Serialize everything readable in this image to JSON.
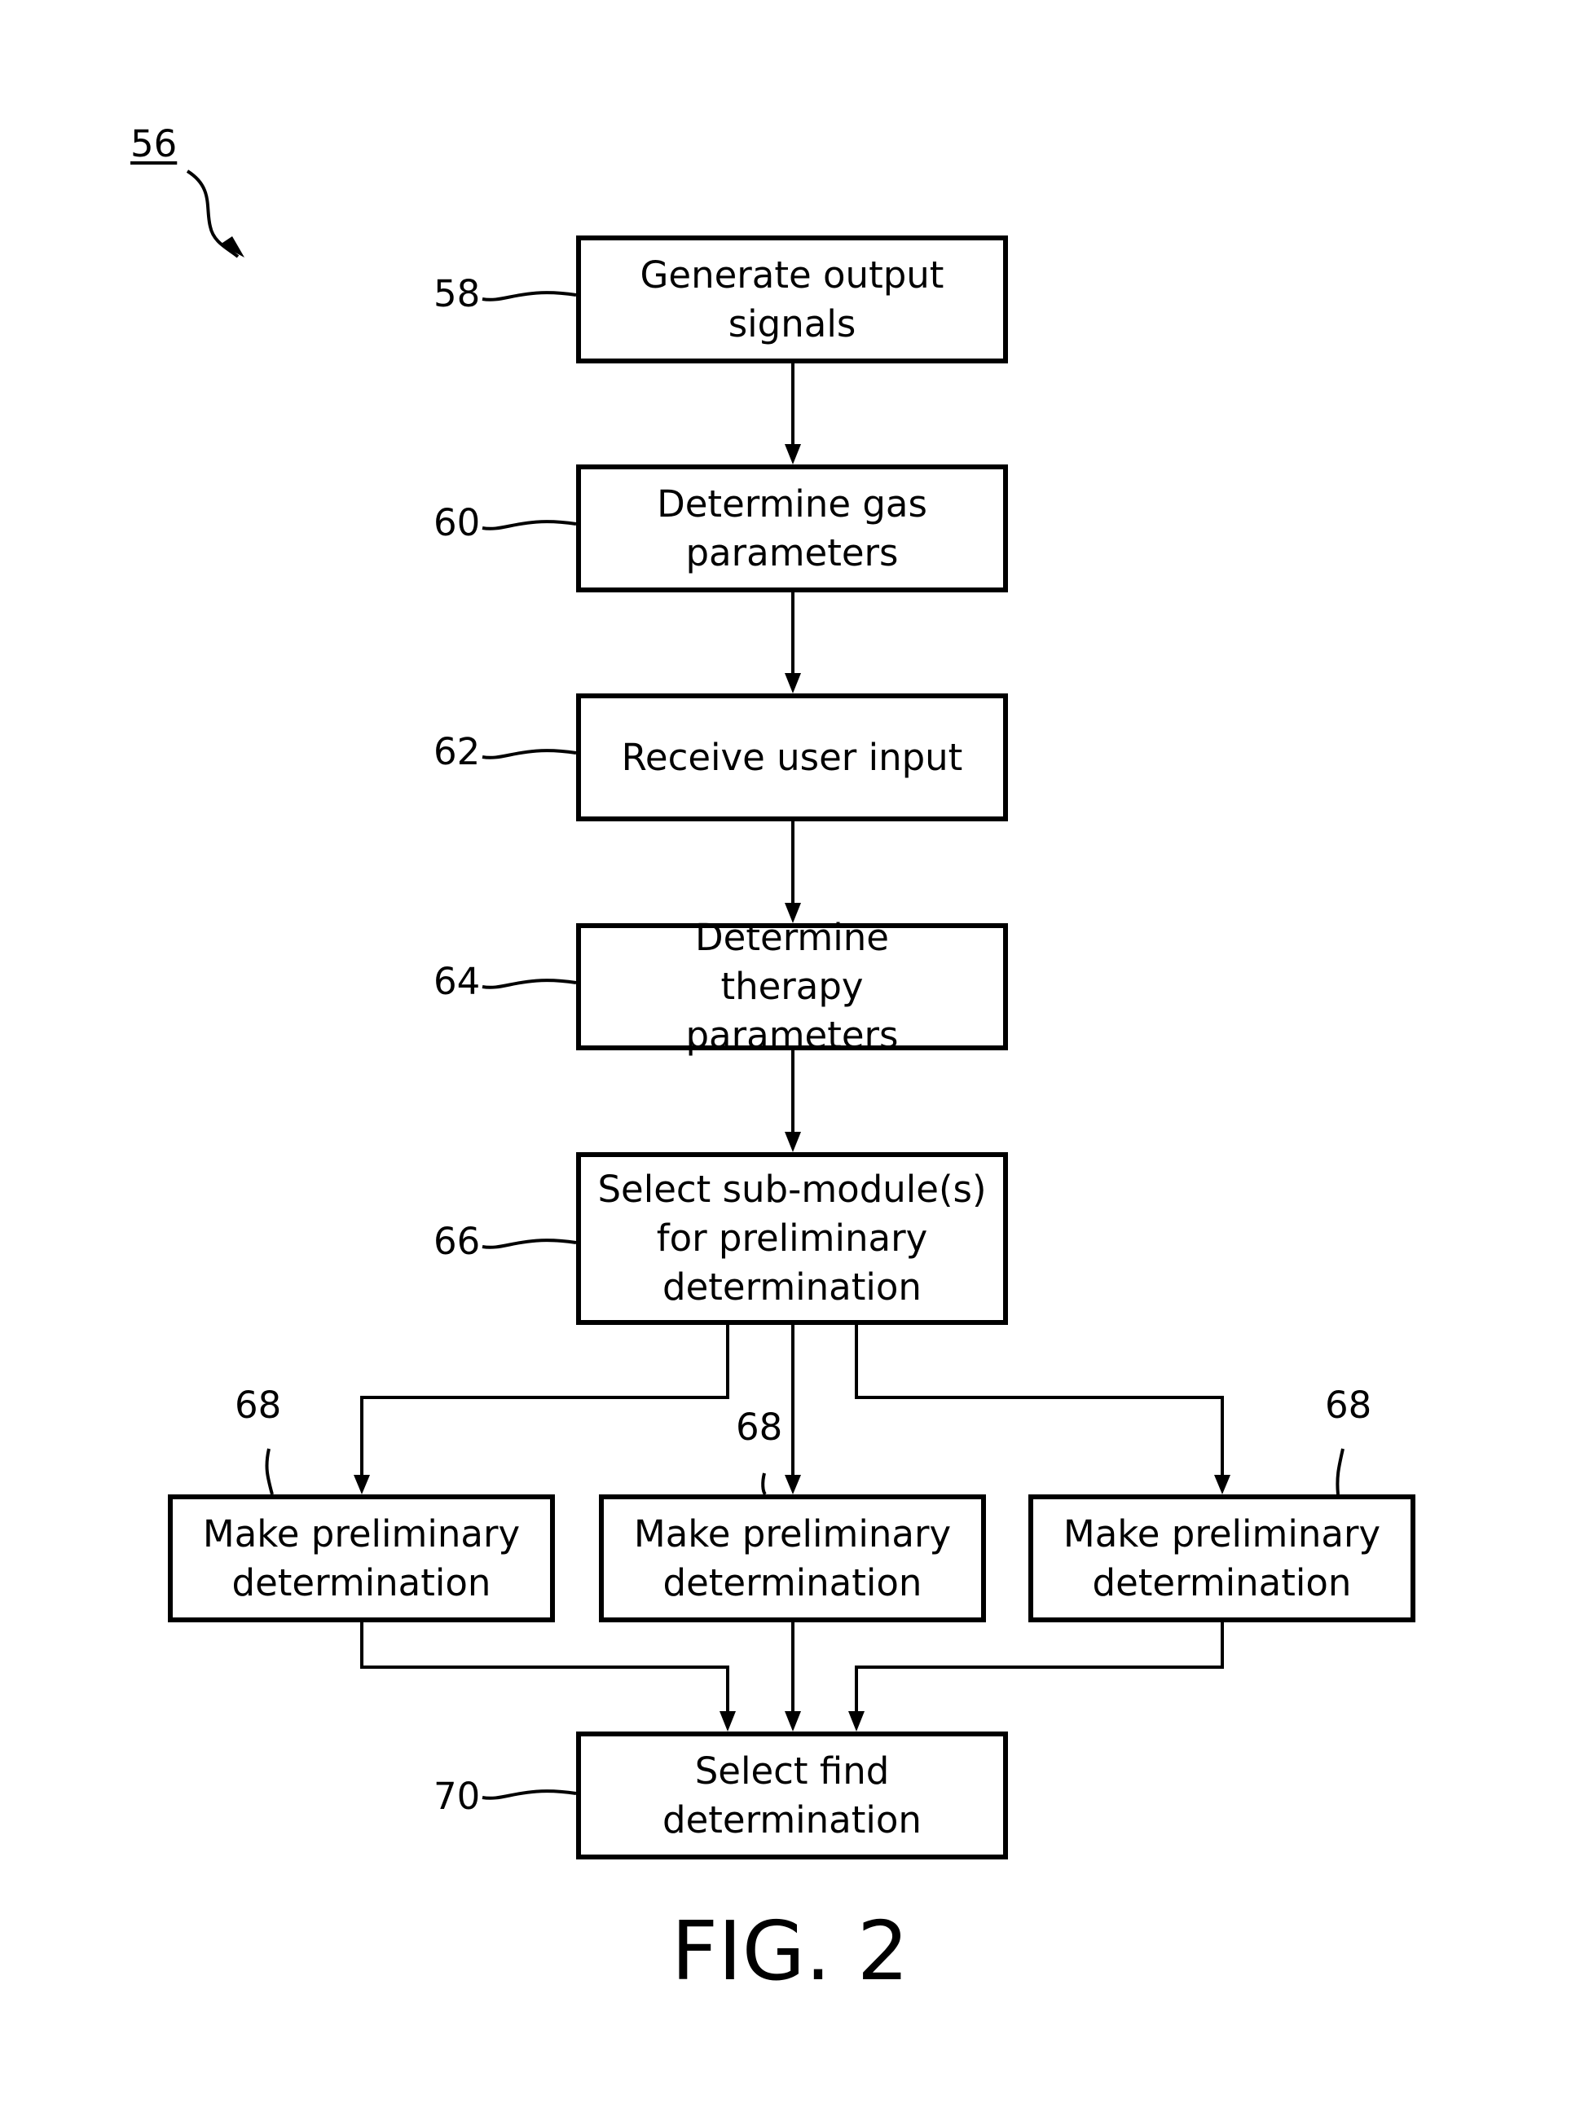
{
  "figure": {
    "number_label": "56",
    "caption": "FIG. 2"
  },
  "steps": [
    {
      "ref": "58",
      "label": "Generate output signals"
    },
    {
      "ref": "60",
      "label": "Determine gas parameters"
    },
    {
      "ref": "62",
      "label": "Receive user input"
    },
    {
      "ref": "64",
      "label": "Determine therapy parameters"
    },
    {
      "ref": "66",
      "label": "Select sub-module(s) for preliminary determination"
    }
  ],
  "preliminary": [
    {
      "ref": "68",
      "label": "Make preliminary determination"
    },
    {
      "ref": "68",
      "label": "Make preliminary determination"
    },
    {
      "ref": "68",
      "label": "Make preliminary determination"
    }
  ],
  "final": {
    "ref": "70",
    "label": "Select find determination"
  }
}
